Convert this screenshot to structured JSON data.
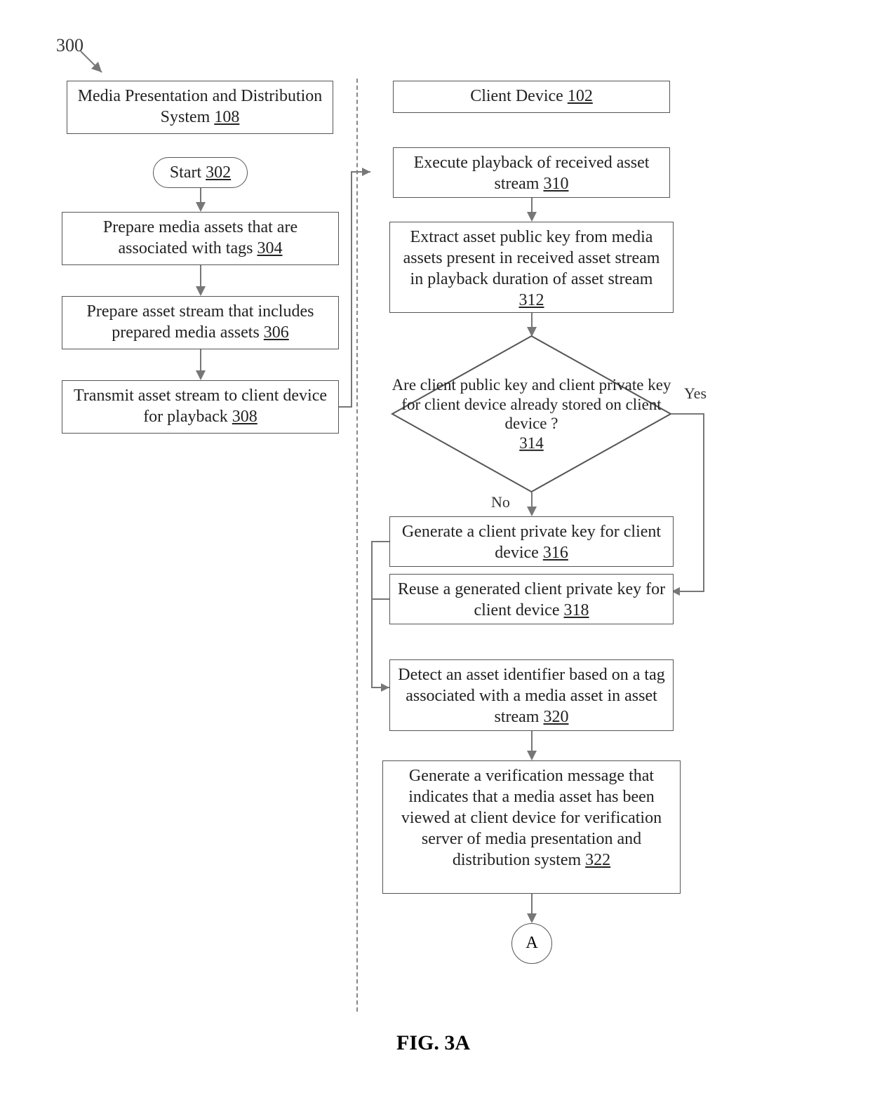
{
  "figure_ref": "300",
  "figure_caption": "FIG. 3A",
  "left": {
    "header": {
      "text": "Media Presentation and Distribution System",
      "ref": "108"
    },
    "start": {
      "text": "Start",
      "ref": "302"
    },
    "step304": {
      "text": "Prepare media assets that are associated with tags",
      "ref": "304"
    },
    "step306": {
      "text": "Prepare asset stream that includes prepared media assets",
      "ref": "306"
    },
    "step308": {
      "text": "Transmit asset stream to client device for playback",
      "ref": "308"
    }
  },
  "right": {
    "header": {
      "text": "Client Device",
      "ref": "102"
    },
    "step310": {
      "text": "Execute playback of received asset stream",
      "ref": "310"
    },
    "step312": {
      "text": "Extract asset public key from media assets present in received asset stream in playback duration of asset stream",
      "ref": "312"
    },
    "decision314": {
      "text": "Are client public key and client private key for client device already stored on client device ?",
      "ref": "314",
      "yes": "Yes",
      "no": "No"
    },
    "step316": {
      "text": "Generate a client private key for client device",
      "ref": "316"
    },
    "step318": {
      "text": "Reuse a generated client private key for client device",
      "ref": "318"
    },
    "step320": {
      "text": "Detect an asset identifier based on a tag associated with a media asset in asset stream",
      "ref": "320"
    },
    "step322": {
      "text": "Generate a verification message that indicates that a media asset has been viewed at client device for verification server of media presentation and distribution system",
      "ref": "322"
    },
    "connector": "A"
  }
}
